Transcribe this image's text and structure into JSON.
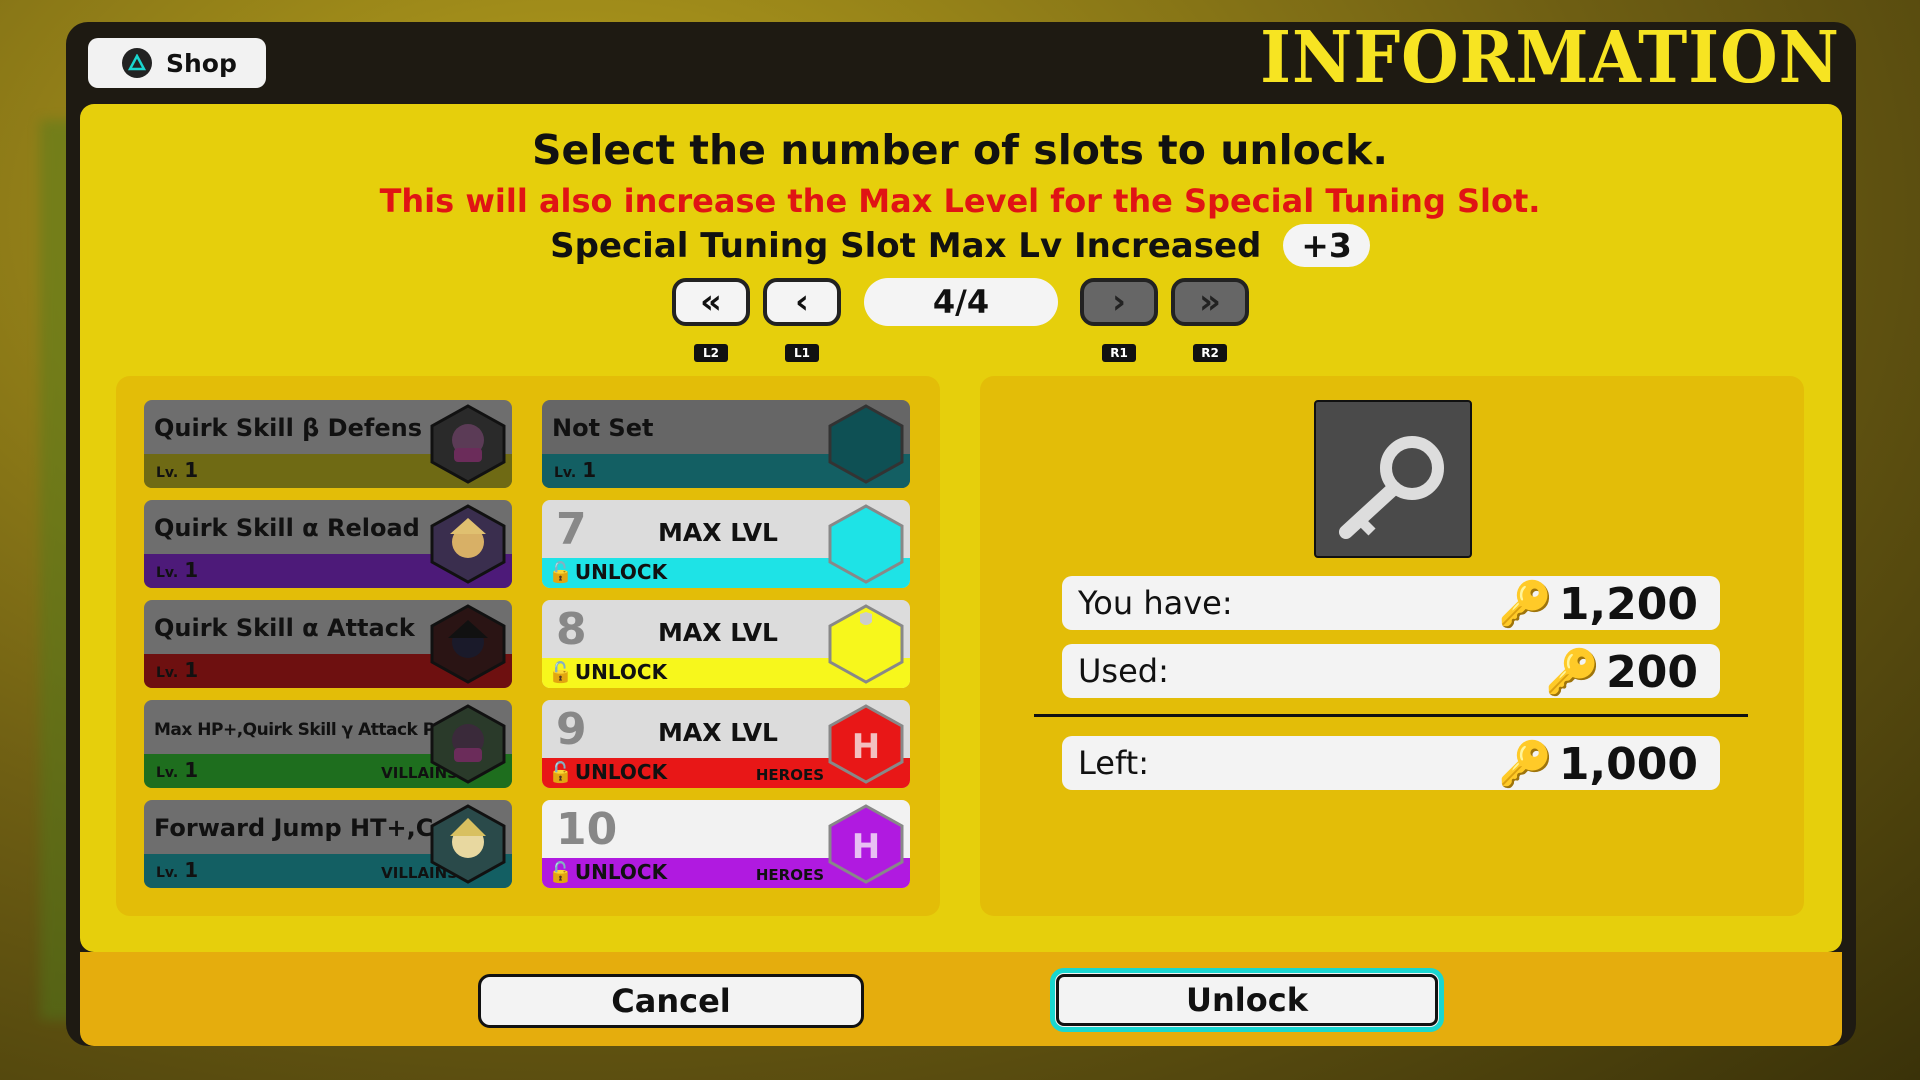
{
  "top": {
    "shop_label": "Shop",
    "title": "INFORMATION"
  },
  "dialog": {
    "heading": "Select the number of slots to unlock.",
    "warning": "This will also increase the Max Level for the Special Tuning Slot.",
    "increase_label": "Special Tuning Slot Max Lv Increased",
    "increase_value": "+3",
    "page": "4/4",
    "nav": {
      "first": "«",
      "prev": "‹",
      "next": "›",
      "last": "»",
      "l2": "L2",
      "l1": "L1",
      "r1": "R1",
      "r2": "R2"
    }
  },
  "skills": [
    {
      "name": "Quirk Skill β Defens",
      "lv_label": "Lv.",
      "lv": "1",
      "side": "",
      "color": "#6f6a14"
    },
    {
      "name": "Quirk Skill α Reload",
      "lv_label": "Lv.",
      "lv": "1",
      "side": "",
      "color": "#4d1a79"
    },
    {
      "name": "Quirk Skill α Attack",
      "lv_label": "Lv.",
      "lv": "1",
      "side": "",
      "color": "#6e1010"
    },
    {
      "name": "Max HP+,Quirk Skill γ Attack Power+",
      "lv_label": "Lv.",
      "lv": "1",
      "side": "VILLAINS",
      "color": "#1e6e1e"
    },
    {
      "name": "Forward Jump HT+,C",
      "lv_label": "Lv.",
      "lv": "1",
      "side": "VILLAINS",
      "color": "#135f63"
    }
  ],
  "slots": [
    {
      "name": "Not Set",
      "lv_label": "Lv.",
      "lv": "1",
      "color": "#135f63"
    },
    {
      "num": "7",
      "max": "MAX LVL",
      "unlock": "UNLOCK",
      "side": "",
      "color": "#1ee3e6"
    },
    {
      "num": "8",
      "max": "MAX LVL",
      "unlock": "UNLOCK",
      "side": "",
      "color": "#f7f71c"
    },
    {
      "num": "9",
      "max": "MAX LVL",
      "unlock": "UNLOCK",
      "side": "HEROES",
      "color": "#e81717"
    },
    {
      "num": "10",
      "max": "",
      "unlock": "UNLOCK",
      "side": "HEROES",
      "color": "#b01ae0"
    }
  ],
  "summary": {
    "have_label": "You have:",
    "have_value": "1,200",
    "used_label": "Used:",
    "used_value": "200",
    "left_label": "Left:",
    "left_value": "1,000",
    "item_icon": "key-icon"
  },
  "buttons": {
    "cancel": "Cancel",
    "unlock": "Unlock"
  }
}
